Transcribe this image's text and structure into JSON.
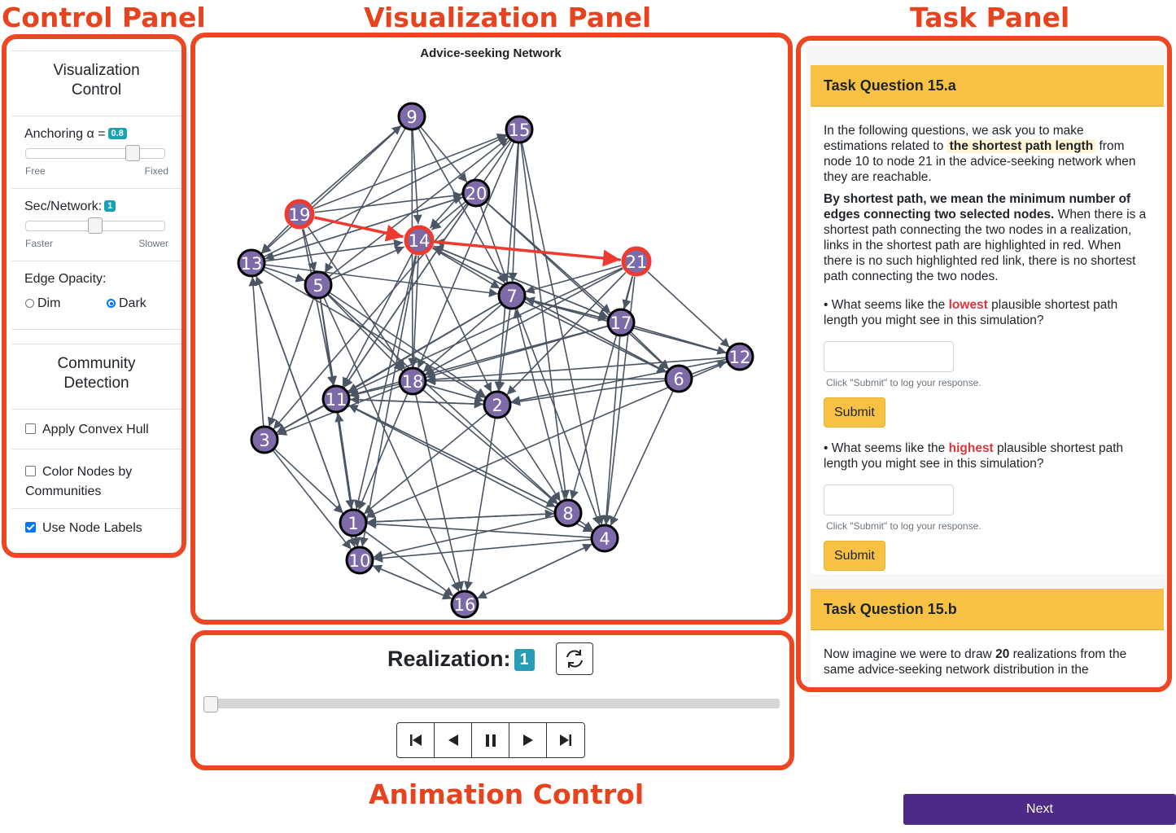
{
  "annotations": {
    "control_panel": "Control Panel",
    "visualization_panel": "Visualization Panel",
    "task_panel": "Task Panel",
    "animation_control": "Animation Control"
  },
  "control": {
    "viz_control_title": "Visualization Control",
    "anchoring_label": "Anchoring α =",
    "anchoring_value": "0.8",
    "anchoring_fraction": 0.8,
    "free": "Free",
    "fixed": "Fixed",
    "sec_label": "Sec/Network:",
    "sec_value": "1",
    "sec_fraction": 0.5,
    "faster": "Faster",
    "slower": "Slower",
    "edge_opacity_label": "Edge Opacity:",
    "dim": "Dim",
    "dark": "Dark",
    "edge_opacity_selected": "Dark",
    "community_title": "Community Detection",
    "convex_hull": "Apply Convex Hull",
    "convex_hull_checked": false,
    "color_nodes": "Color Nodes by Communities",
    "color_nodes_checked": false,
    "node_labels": "Use Node Labels",
    "node_labels_checked": true
  },
  "network": {
    "title": "Advice-seeking Network",
    "node_color": "#7c6ba8",
    "highlight_color": "#ee3a2f",
    "edge_color": "#4b5563",
    "nodes": [
      {
        "id": "1"
      },
      {
        "id": "2"
      },
      {
        "id": "3"
      },
      {
        "id": "4"
      },
      {
        "id": "5"
      },
      {
        "id": "6"
      },
      {
        "id": "7"
      },
      {
        "id": "8"
      },
      {
        "id": "9"
      },
      {
        "id": "10"
      },
      {
        "id": "11"
      },
      {
        "id": "12"
      },
      {
        "id": "13"
      },
      {
        "id": "14"
      },
      {
        "id": "15"
      },
      {
        "id": "16"
      },
      {
        "id": "17"
      },
      {
        "id": "18"
      },
      {
        "id": "19"
      },
      {
        "id": "20"
      },
      {
        "id": "21"
      }
    ],
    "highlighted_nodes": [
      "19",
      "14",
      "21"
    ],
    "highlighted_edges": [
      [
        "19",
        "14"
      ],
      [
        "14",
        "21"
      ]
    ],
    "edges": [
      [
        "19",
        "9"
      ],
      [
        "19",
        "20"
      ],
      [
        "19",
        "15"
      ],
      [
        "19",
        "13"
      ],
      [
        "19",
        "5"
      ],
      [
        "19",
        "18"
      ],
      [
        "19",
        "11"
      ],
      [
        "13",
        "15"
      ],
      [
        "13",
        "14"
      ],
      [
        "13",
        "7"
      ],
      [
        "13",
        "20"
      ],
      [
        "13",
        "5"
      ],
      [
        "13",
        "10"
      ],
      [
        "13",
        "2"
      ],
      [
        "5",
        "14"
      ],
      [
        "5",
        "11"
      ],
      [
        "5",
        "1"
      ],
      [
        "5",
        "10"
      ],
      [
        "5",
        "2"
      ],
      [
        "5",
        "8"
      ],
      [
        "5",
        "18"
      ],
      [
        "5",
        "16"
      ],
      [
        "5",
        "15"
      ],
      [
        "5",
        "3"
      ],
      [
        "9",
        "14"
      ],
      [
        "9",
        "20"
      ],
      [
        "9",
        "18"
      ],
      [
        "9",
        "7"
      ],
      [
        "9",
        "13"
      ],
      [
        "9",
        "5"
      ],
      [
        "15",
        "14"
      ],
      [
        "15",
        "11"
      ],
      [
        "15",
        "4"
      ],
      [
        "15",
        "8"
      ],
      [
        "15",
        "7"
      ],
      [
        "15",
        "2"
      ],
      [
        "15",
        "18"
      ],
      [
        "20",
        "14"
      ],
      [
        "20",
        "11"
      ],
      [
        "20",
        "3"
      ],
      [
        "20",
        "7"
      ],
      [
        "20",
        "17"
      ],
      [
        "20",
        "13"
      ],
      [
        "20",
        "6"
      ],
      [
        "14",
        "7"
      ],
      [
        "14",
        "17"
      ],
      [
        "14",
        "11"
      ],
      [
        "14",
        "1"
      ],
      [
        "14",
        "18"
      ],
      [
        "14",
        "6"
      ],
      [
        "14",
        "2"
      ],
      [
        "14",
        "10"
      ],
      [
        "21",
        "14"
      ],
      [
        "21",
        "7"
      ],
      [
        "21",
        "18"
      ],
      [
        "21",
        "11"
      ],
      [
        "21",
        "2"
      ],
      [
        "21",
        "17"
      ],
      [
        "21",
        "12"
      ],
      [
        "21",
        "4"
      ],
      [
        "21",
        "8"
      ],
      [
        "7",
        "18"
      ],
      [
        "7",
        "4"
      ],
      [
        "7",
        "11"
      ],
      [
        "7",
        "6"
      ],
      [
        "7",
        "2"
      ],
      [
        "7",
        "17"
      ],
      [
        "7",
        "3"
      ],
      [
        "17",
        "6"
      ],
      [
        "17",
        "7"
      ],
      [
        "17",
        "12"
      ],
      [
        "17",
        "18"
      ],
      [
        "17",
        "11"
      ],
      [
        "17",
        "4"
      ],
      [
        "17",
        "14"
      ],
      [
        "6",
        "12"
      ],
      [
        "6",
        "2"
      ],
      [
        "6",
        "18"
      ],
      [
        "6",
        "4"
      ],
      [
        "6",
        "14"
      ],
      [
        "12",
        "1"
      ],
      [
        "12",
        "2"
      ],
      [
        "12",
        "7"
      ],
      [
        "12",
        "18"
      ],
      [
        "18",
        "2"
      ],
      [
        "18",
        "11"
      ],
      [
        "18",
        "1"
      ],
      [
        "18",
        "16"
      ],
      [
        "18",
        "8"
      ],
      [
        "18",
        "3"
      ],
      [
        "11",
        "1"
      ],
      [
        "11",
        "10"
      ],
      [
        "11",
        "4"
      ],
      [
        "11",
        "8"
      ],
      [
        "11",
        "3"
      ],
      [
        "11",
        "2"
      ],
      [
        "3",
        "10"
      ],
      [
        "3",
        "1"
      ],
      [
        "3",
        "13"
      ],
      [
        "2",
        "16"
      ],
      [
        "2",
        "8"
      ],
      [
        "2",
        "1"
      ],
      [
        "2",
        "11"
      ],
      [
        "8",
        "1"
      ],
      [
        "8",
        "10"
      ],
      [
        "8",
        "11"
      ],
      [
        "8",
        "4"
      ],
      [
        "8",
        "7"
      ],
      [
        "4",
        "1"
      ],
      [
        "4",
        "16"
      ],
      [
        "4",
        "10"
      ],
      [
        "1",
        "10"
      ],
      [
        "1",
        "16"
      ],
      [
        "10",
        "16"
      ],
      [
        "16",
        "10"
      ],
      [
        "16",
        "4"
      ],
      [
        "10",
        "13"
      ],
      [
        "1",
        "11"
      ],
      [
        "1",
        "8"
      ]
    ]
  },
  "animation": {
    "realization_label": "Realization:",
    "realization_value": "1",
    "progress_fraction": 0
  },
  "task": {
    "q15a_title": "Task Question 15.a",
    "intro_pre": "In the following questions, we ask you to make estimations related to",
    "intro_highlight": "the shortest path length",
    "intro_post": "from node 10 to node 21 in the advice-seeking network when they are reachable.",
    "def_bold": "By shortest path, we mean the minimum number of edges connecting two selected nodes.",
    "def_rest": "When there is a shortest path connecting the two nodes in a realization, links in the shortest path are highlighted in red. When there is no such highlighted red link, there is no shortest path connecting the two nodes.",
    "q_low_pre": "• What seems like the",
    "q_low_word": "lowest",
    "q_low_post": "plausible shortest path length you might see in this simulation?",
    "q_high_pre": "• What seems like the",
    "q_high_word": "highest",
    "q_high_post": "plausible shortest path length you might see in this simulation?",
    "hint": "Click \"Submit\" to log your response.",
    "submit": "Submit",
    "q15b_title": "Task Question 15.b",
    "q15b_pre": "Now imagine we were to draw",
    "q15b_num": "20",
    "q15b_post": "realizations from the same advice-seeking network distribution in the"
  },
  "next_button": "Next"
}
